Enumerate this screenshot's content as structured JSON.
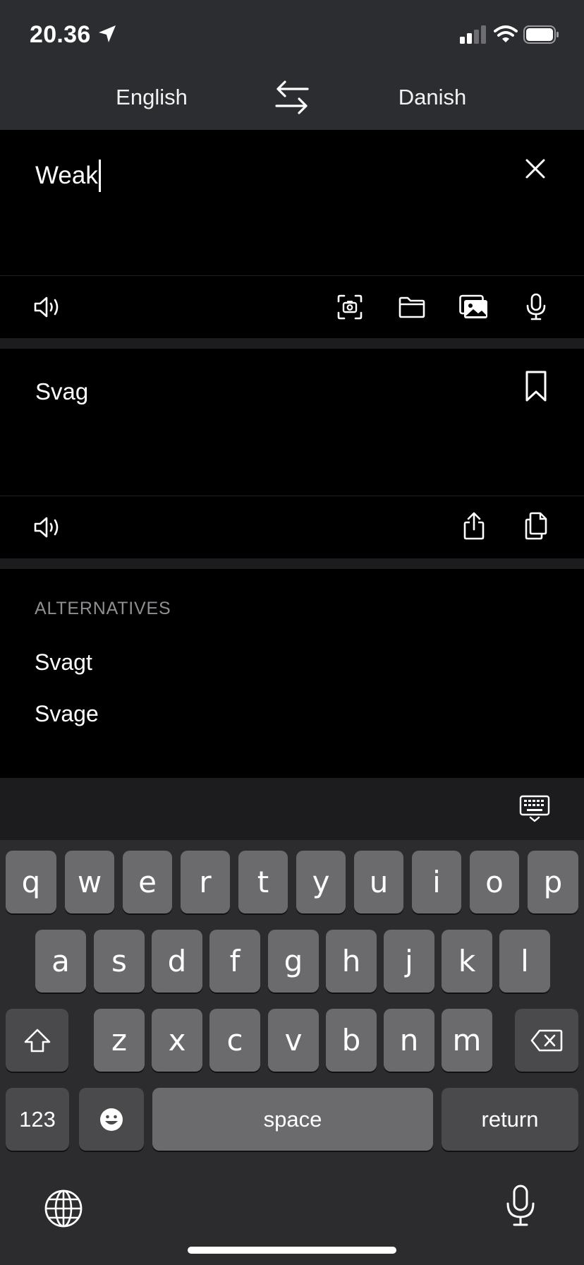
{
  "status_bar": {
    "time": "20.36",
    "icons": [
      "location-arrow-icon",
      "cellular-signal-icon",
      "wifi-icon",
      "battery-icon"
    ]
  },
  "language_bar": {
    "source_language": "English",
    "target_language": "Danish",
    "swap_icon": "swap-arrows-icon"
  },
  "source": {
    "text": "Weak",
    "clear_icon": "close-icon",
    "toolbar_icons": [
      "speaker-icon",
      "camera-scan-icon",
      "folder-icon",
      "photos-icon",
      "microphone-icon"
    ]
  },
  "result": {
    "text": "Svag",
    "bookmark_icon": "bookmark-icon",
    "toolbar_icons": [
      "speaker-icon",
      "share-icon",
      "copy-icon"
    ]
  },
  "alternatives": {
    "header": "ALTERNATIVES",
    "items": [
      "Svagt",
      "Svage"
    ]
  },
  "keyboard": {
    "dismiss_icon": "keyboard-dismiss-icon",
    "row1": [
      "q",
      "w",
      "e",
      "r",
      "t",
      "y",
      "u",
      "i",
      "o",
      "p"
    ],
    "row2": [
      "a",
      "s",
      "d",
      "f",
      "g",
      "h",
      "j",
      "k",
      "l"
    ],
    "row3": [
      "z",
      "x",
      "c",
      "v",
      "b",
      "n",
      "m"
    ],
    "numbers_label": "123",
    "space_label": "space",
    "return_label": "return",
    "icons": [
      "shift-icon",
      "delete-icon",
      "emoji-icon",
      "globe-icon",
      "dictation-icon"
    ]
  }
}
